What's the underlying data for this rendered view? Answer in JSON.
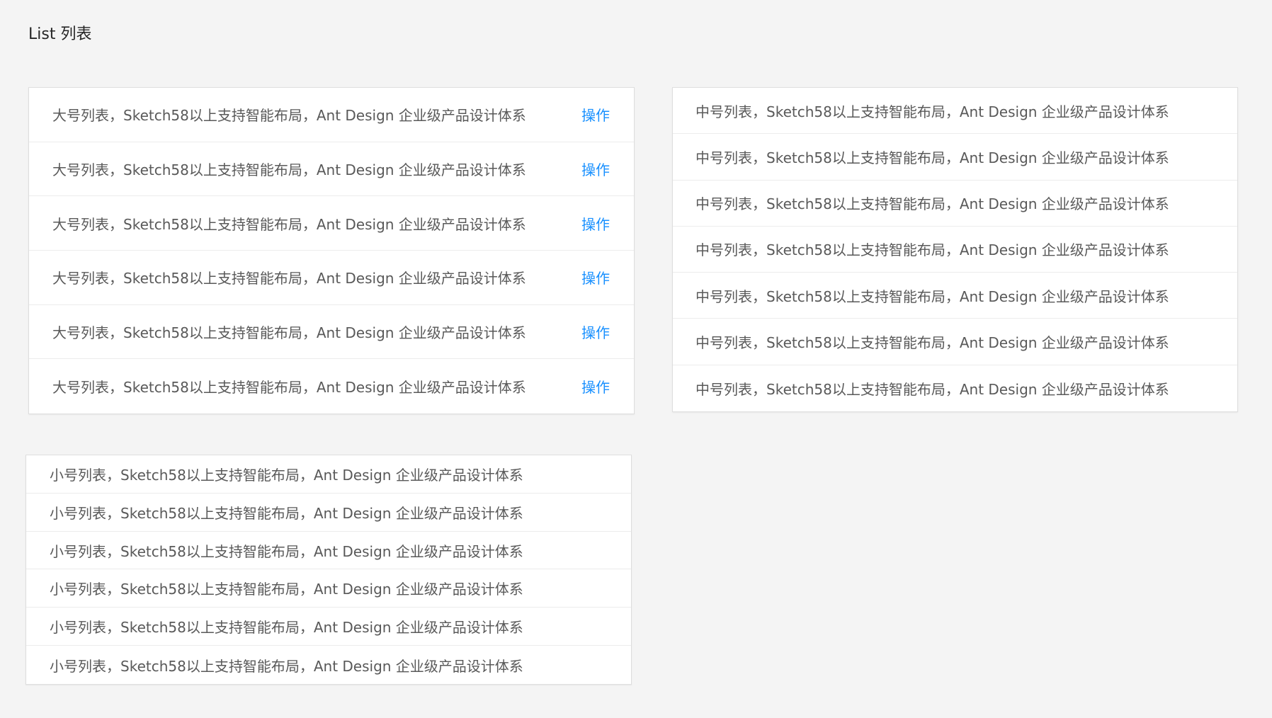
{
  "header": {
    "title": "List 列表"
  },
  "colors": {
    "background": "#f4f4f4",
    "card": "#ffffff",
    "text": "#595959",
    "link": "#1890ff"
  },
  "large_list": {
    "items": [
      {
        "text": "大号列表，Sketch58以上支持智能布局，Ant Design 企业级产品设计体系",
        "action": "操作"
      },
      {
        "text": "大号列表，Sketch58以上支持智能布局，Ant Design 企业级产品设计体系",
        "action": "操作"
      },
      {
        "text": "大号列表，Sketch58以上支持智能布局，Ant Design 企业级产品设计体系",
        "action": "操作"
      },
      {
        "text": "大号列表，Sketch58以上支持智能布局，Ant Design 企业级产品设计体系",
        "action": "操作"
      },
      {
        "text": "大号列表，Sketch58以上支持智能布局，Ant Design 企业级产品设计体系",
        "action": "操作"
      },
      {
        "text": "大号列表，Sketch58以上支持智能布局，Ant Design 企业级产品设计体系",
        "action": "操作"
      }
    ]
  },
  "medium_list": {
    "items": [
      {
        "text": "中号列表，Sketch58以上支持智能布局，Ant Design 企业级产品设计体系"
      },
      {
        "text": "中号列表，Sketch58以上支持智能布局，Ant Design 企业级产品设计体系"
      },
      {
        "text": "中号列表，Sketch58以上支持智能布局，Ant Design 企业级产品设计体系"
      },
      {
        "text": "中号列表，Sketch58以上支持智能布局，Ant Design 企业级产品设计体系"
      },
      {
        "text": "中号列表，Sketch58以上支持智能布局，Ant Design 企业级产品设计体系"
      },
      {
        "text": "中号列表，Sketch58以上支持智能布局，Ant Design 企业级产品设计体系"
      },
      {
        "text": "中号列表，Sketch58以上支持智能布局，Ant Design 企业级产品设计体系"
      }
    ]
  },
  "small_list": {
    "items": [
      {
        "text": "小号列表，Sketch58以上支持智能布局，Ant Design 企业级产品设计体系"
      },
      {
        "text": "小号列表，Sketch58以上支持智能布局，Ant Design 企业级产品设计体系"
      },
      {
        "text": "小号列表，Sketch58以上支持智能布局，Ant Design 企业级产品设计体系"
      },
      {
        "text": "小号列表，Sketch58以上支持智能布局，Ant Design 企业级产品设计体系"
      },
      {
        "text": "小号列表，Sketch58以上支持智能布局，Ant Design 企业级产品设计体系"
      },
      {
        "text": "小号列表，Sketch58以上支持智能布局，Ant Design 企业级产品设计体系"
      }
    ]
  }
}
